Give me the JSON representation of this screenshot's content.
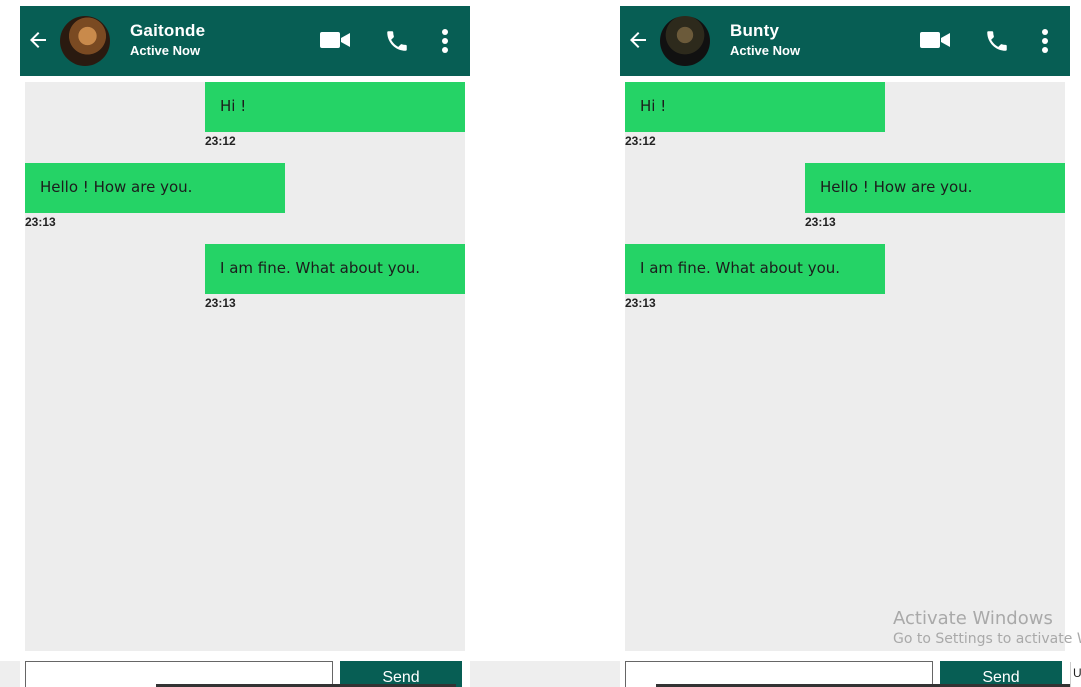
{
  "chats": [
    {
      "contact": {
        "name": "Gaitonde",
        "status": "Active Now"
      },
      "messages": [
        {
          "text": "Hi !",
          "time": "23:12",
          "side": "right"
        },
        {
          "text": "Hello ! How are you.",
          "time": "23:13",
          "side": "left"
        },
        {
          "text": "I am fine. What about you.",
          "time": "23:13",
          "side": "right"
        }
      ],
      "input": {
        "value": "",
        "placeholder": ""
      },
      "send_label": "Send"
    },
    {
      "contact": {
        "name": "Bunty",
        "status": "Active Now"
      },
      "messages": [
        {
          "text": "Hi !",
          "time": "23:12",
          "side": "left"
        },
        {
          "text": "Hello ! How are you.",
          "time": "23:13",
          "side": "right"
        },
        {
          "text": "I am fine. What about you.",
          "time": "23:13",
          "side": "left"
        }
      ],
      "input": {
        "value": "",
        "placeholder": ""
      },
      "send_label": "Send"
    }
  ],
  "icons": {
    "back": "arrow-left-icon",
    "video": "video-camera-icon",
    "call": "phone-icon",
    "more": "more-vertical-icon"
  },
  "watermark": {
    "line1": "Activate Windows",
    "line2": "Go to Settings to activate Wi"
  },
  "edge_fragment": "U",
  "colors": {
    "header": "#075e54",
    "bubble": "#25d366",
    "chat_background": "#ededed",
    "send_button": "#075e54"
  }
}
